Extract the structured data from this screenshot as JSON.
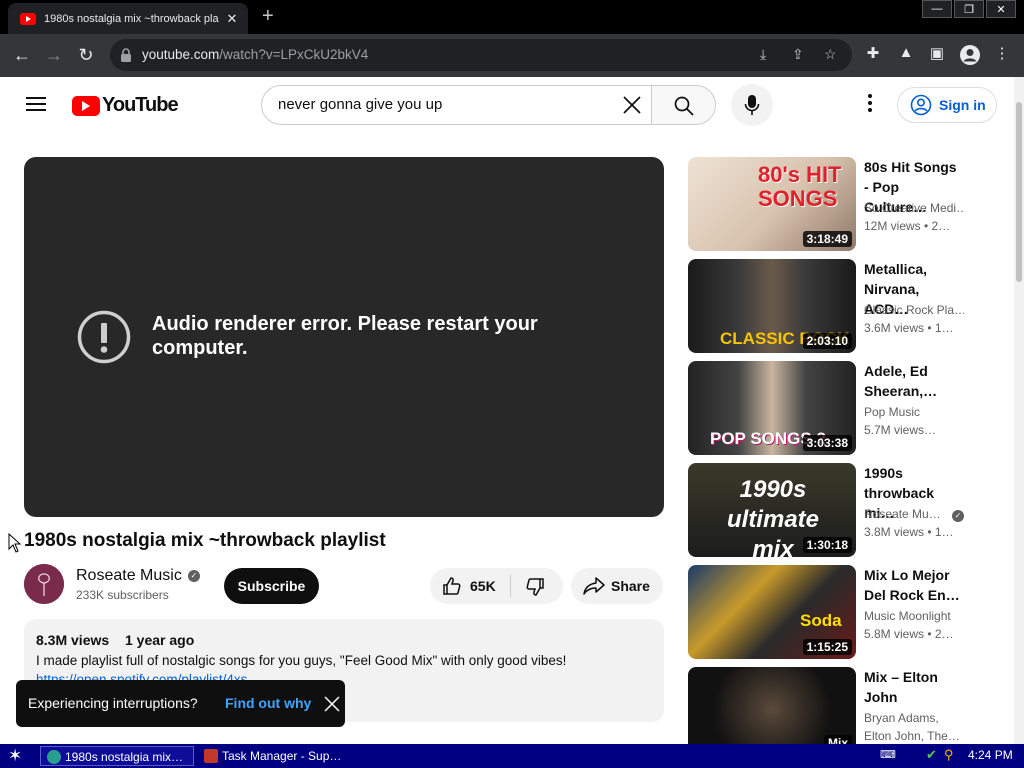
{
  "browser": {
    "tab_title": "1980s nostalgia mix ~throwback pla",
    "url_host": "youtube.com",
    "url_path": "/watch?v=LPxCkU2bkV4",
    "icons": [
      "back-icon",
      "forward-icon",
      "reload-icon",
      "lock-icon",
      "install-icon",
      "share-icon",
      "star-icon",
      "extensions-icon",
      "profile-labs-icon",
      "side-panel-icon",
      "account-icon",
      "menu-icon"
    ]
  },
  "youtube": {
    "logo_text": "YouTube",
    "search_value": "never gonna give you up",
    "sign_in": "Sign in"
  },
  "player": {
    "error_message": "Audio renderer error. Please restart your computer."
  },
  "video": {
    "title": "1980s nostalgia mix ~throwback playlist",
    "channel": "Roseate Music",
    "subscribers": "233K subscribers",
    "subscribe_label": "Subscribe",
    "likes": "65K",
    "share_label": "Share",
    "views": "8.3M views",
    "age": "1 year ago",
    "description": "I made playlist full of nostalgic songs for you guys, \"Feel Good Mix\" with only good vibes!",
    "link": "https://open.spotify.com/playlist/4xs..."
  },
  "toast": {
    "message": "Experiencing interruptions?",
    "action": "Find out why"
  },
  "recommendations": [
    {
      "title": "80s Hit Songs - Pop Culture…",
      "channel": "So Creative Medi…",
      "meta": "12M views  • 2…",
      "duration": "3:18:49",
      "thumb_text": "80's HIT SONGS",
      "thumb_color": "#d6c2b0"
    },
    {
      "title": "Metallica, Nirvana, ACD…",
      "channel": "Classic Rock Pla…",
      "meta": "3.6M views  • 1…",
      "duration": "2:03:10",
      "thumb_text": "CLASSIC ROCK",
      "thumb_color": "#2a2a2a"
    },
    {
      "title": "Adele, Ed Sheeran,…",
      "channel": "Pop Music",
      "meta": "5.7M views…",
      "duration": "3:03:38",
      "thumb_text": "POP SONGS 2",
      "thumb_color": "#3a3a3a"
    },
    {
      "title": "1990s throwback mi…",
      "channel": "Roseate Mu…",
      "meta": "3.8M views  • 1…",
      "duration": "1:30:18",
      "thumb_text": "1990s ultimate mix",
      "thumb_color": "#1c1c1c"
    },
    {
      "title": "Mix Lo Mejor Del Rock En…",
      "channel": "Music Moonlight",
      "meta": "5.8M views  • 2…",
      "duration": "1:15:25",
      "thumb_text": "Soda",
      "thumb_color": "#4a4a4a"
    },
    {
      "title": "Mix – Elton John",
      "channel": "Bryan Adams,",
      "meta": "Elton John, The…",
      "duration": "Mix",
      "thumb_text": "",
      "thumb_color": "#111111"
    }
  ],
  "taskbar": {
    "tasks": [
      "1980s nostalgia mix…",
      "Task Manager - Sup…"
    ],
    "clock": "4:24 PM"
  }
}
